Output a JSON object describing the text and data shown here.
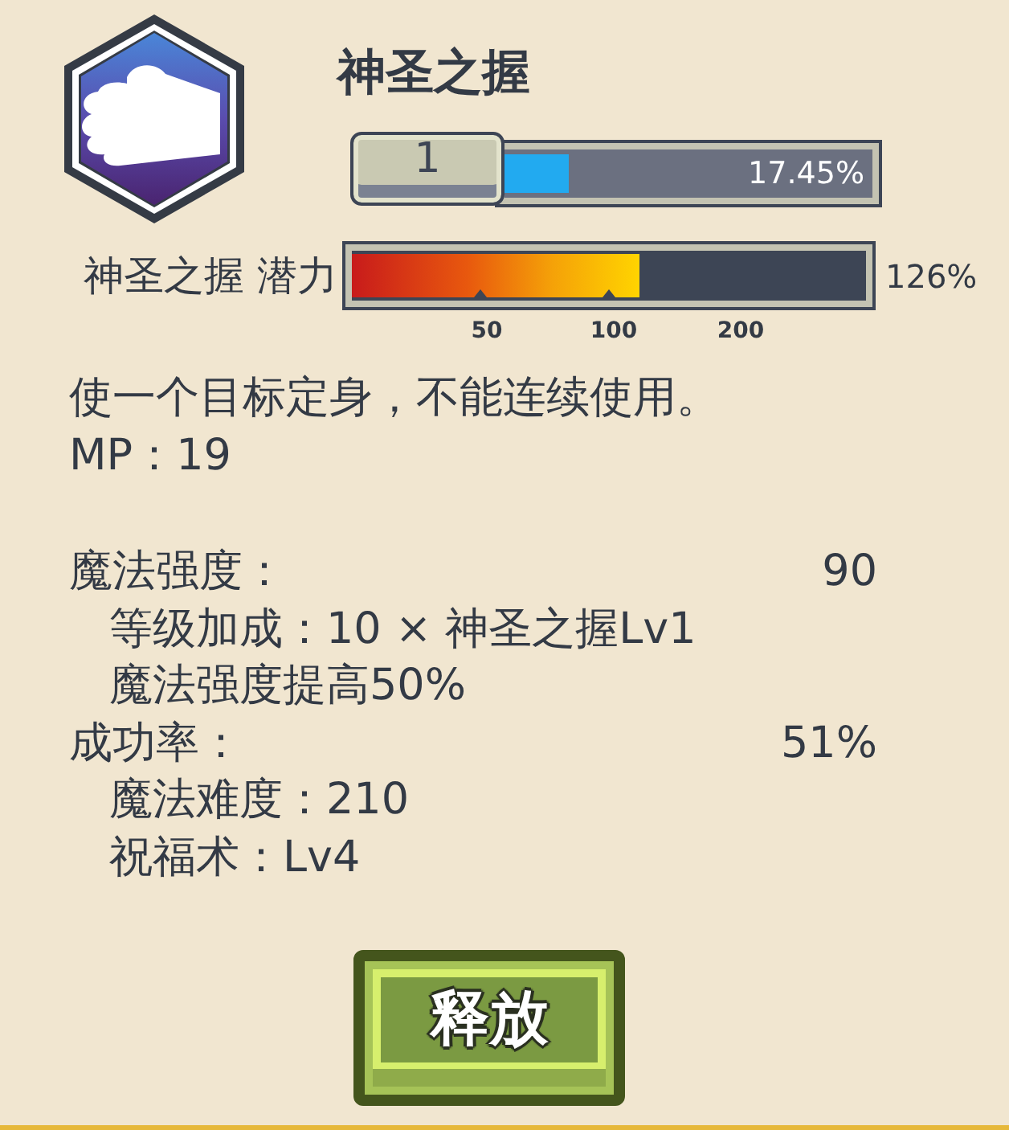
{
  "skill": {
    "name": "神圣之握"
  },
  "experience": {
    "rank": "1",
    "level": 0.1745,
    "reading": "17.45%"
  },
  "potential": {
    "label": "神圣之握 潜力",
    "level": 0.56,
    "reading": "126%",
    "ticks": [
      "50",
      "100",
      "200"
    ]
  },
  "description": [
    "使一个目标定身，不能连续使用。",
    "MP：19"
  ],
  "stats": [
    {
      "label": "魔法强度：",
      "value": "90",
      "children": [
        {
          "text": "等级加成：10 × 神圣之握Lv1"
        },
        {
          "text": "魔法强度提高50%"
        }
      ]
    },
    {
      "label": "成功率：",
      "value": "51%",
      "children": [
        {
          "text": "魔法难度：210"
        },
        {
          "text": "祝福术：Lv4"
        }
      ]
    }
  ],
  "action_button": {
    "label": "释放"
  }
}
